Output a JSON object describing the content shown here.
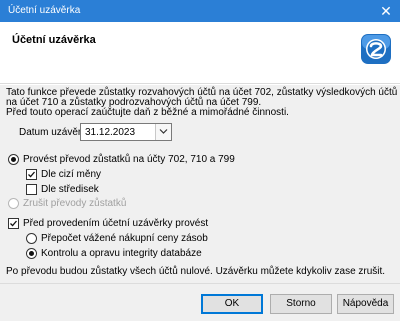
{
  "window": {
    "title": "Účetní uzávěrka"
  },
  "header": {
    "title": "Účetní uzávěrka"
  },
  "description": {
    "line1": "Tato funkce převede zůstatky rozvahových účtů na účet 702, zůstatky výsledkových účtů",
    "line2": "na účet 710 a zůstatky podrozvahových účtů na účet 799.",
    "line3": "Před touto operací zaúčtujte daň z běžné a mimořádné činnosti."
  },
  "date": {
    "label": "Datum uzávěrky",
    "value": "31.12.2023"
  },
  "options": {
    "transfer": {
      "label": "Provést převod zůstatků na účty 702, 710 a 799",
      "selected": true
    },
    "foreign_currency": {
      "label": "Dle cizí měny",
      "checked": true
    },
    "by_center": {
      "label": "Dle středisek",
      "checked": false
    },
    "cancel_transfers": {
      "label": "Zrušit převody zůstatků",
      "selected": false,
      "enabled": false
    },
    "before_closing": {
      "label": "Před provedením účetní uzávěrky provést",
      "checked": true
    },
    "recalc_prices": {
      "label": "Přepočet vážené nákupní ceny zásob",
      "selected": false
    },
    "check_db": {
      "label": "Kontrolu a opravu integrity databáze",
      "selected": true
    }
  },
  "note": "Po převodu budou zůstatky všech účtů nulové. Uzávěrku můžete kdykoliv zase zrušit.",
  "buttons": {
    "ok": "OK",
    "cancel": "Storno",
    "help": "Nápověda"
  },
  "colors": {
    "titlebar": "#2b7fd6",
    "icon": "#1e6fc2",
    "default_button_border": "#0078d7"
  }
}
